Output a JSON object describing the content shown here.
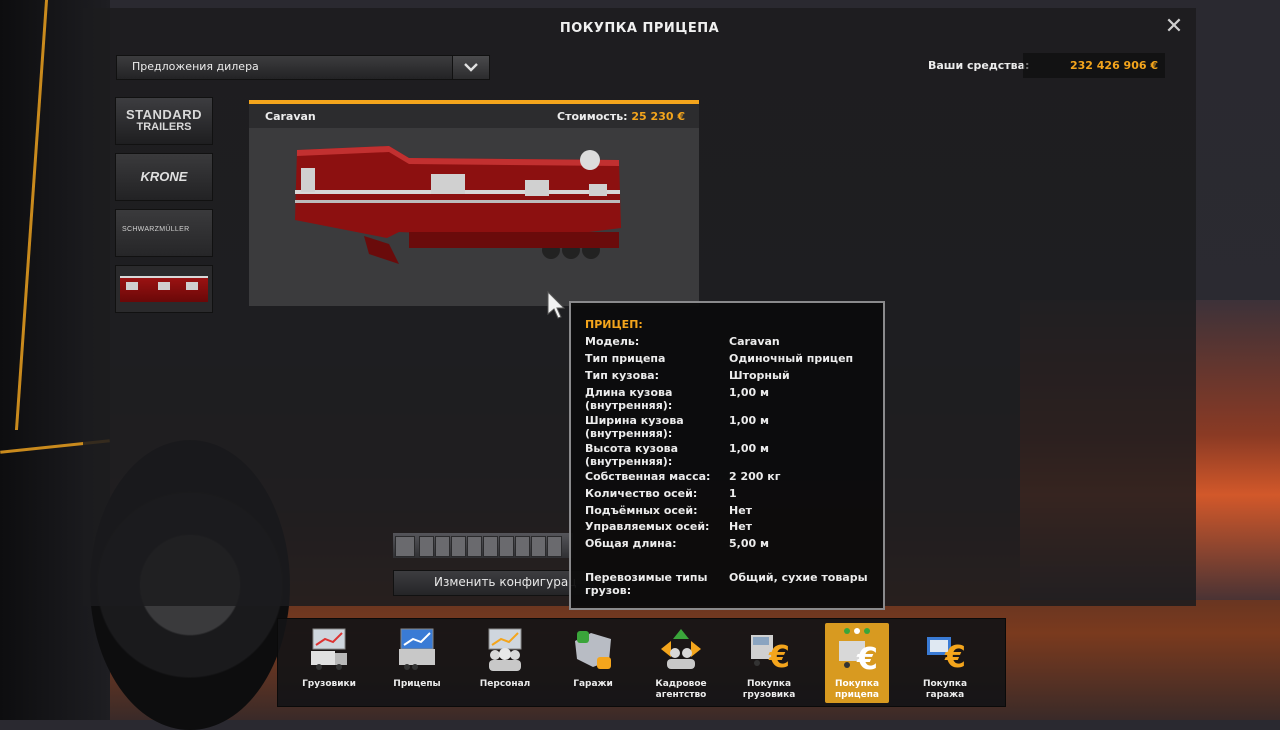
{
  "window": {
    "title": "ПОКУПКА ПРИЦЕПА",
    "close_icon": "close-icon"
  },
  "filter": {
    "selected": "Предложения дилера"
  },
  "funds": {
    "label": "Ваши средства:",
    "value": "232 426 906 €"
  },
  "brands": [
    {
      "name": "STANDARD",
      "sub": "TRAILERS"
    },
    {
      "name": "KRONE"
    },
    {
      "name": "SCHWARZMÜLLER"
    },
    {
      "name": "Caravan thumbnail"
    }
  ],
  "preview": {
    "trailer_name": "Caravan",
    "price_label": "Стоимость:",
    "price_value": "25 230 €"
  },
  "config_button": "Изменить конфигурац",
  "tooltip": {
    "title": "ПРИЦЕП:",
    "rows": [
      {
        "k": "Модель:",
        "v": "Caravan"
      },
      {
        "k": "Тип прицепа",
        "v": "Одиночный прицеп"
      },
      {
        "k": "Тип кузова:",
        "v": "Шторный"
      },
      {
        "k": "Длина кузова (внутренняя):",
        "v": "1,00 м"
      },
      {
        "k": "Ширина кузова (внутренняя):",
        "v": "1,00 м"
      },
      {
        "k": "Высота кузова (внутренняя):",
        "v": "1,00 м"
      },
      {
        "k": "Собственная масса:",
        "v": "2 200 кг"
      },
      {
        "k": "Количество осей:",
        "v": "1"
      },
      {
        "k": "Подъёмных осей:",
        "v": "Нет"
      },
      {
        "k": "Управляемых осей:",
        "v": "Нет"
      },
      {
        "k": "Общая длина:",
        "v": "5,00 м"
      },
      {
        "k": "Перевозимые типы грузов:",
        "v": "Общий, сухие товары"
      }
    ]
  },
  "taskbar": [
    {
      "label": "Грузовики",
      "icon": "trucks-icon"
    },
    {
      "label": "Прицепы",
      "icon": "trailers-icon"
    },
    {
      "label": "Персонал",
      "icon": "staff-icon"
    },
    {
      "label": "Гаражи",
      "icon": "garages-icon"
    },
    {
      "label": "Кадровое агентство",
      "icon": "recruitment-icon"
    },
    {
      "label": "Покупка грузовика",
      "icon": "buy-truck-icon"
    },
    {
      "label": "Покупка прицепа",
      "icon": "buy-trailer-icon",
      "active": true
    },
    {
      "label": "Покупка гаража",
      "icon": "buy-garage-icon"
    }
  ],
  "colors": {
    "accent": "#f4a51c",
    "trailer_red": "#9a1212"
  }
}
